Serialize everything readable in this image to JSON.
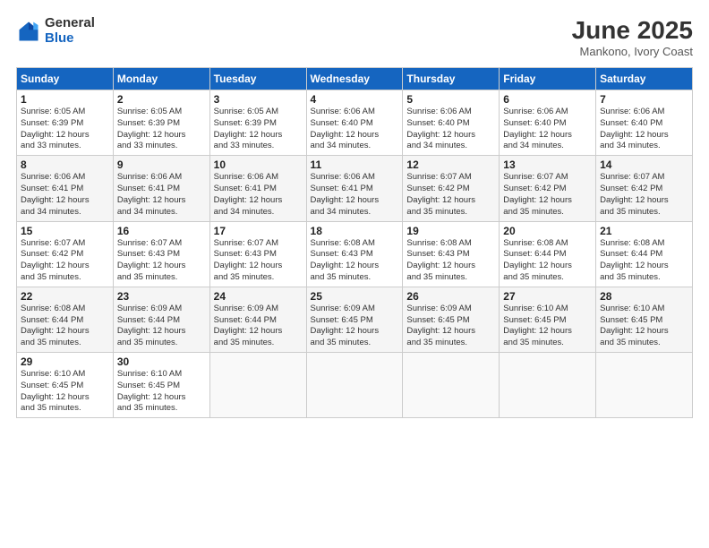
{
  "header": {
    "logo_general": "General",
    "logo_blue": "Blue",
    "month_title": "June 2025",
    "location": "Mankono, Ivory Coast"
  },
  "days_of_week": [
    "Sunday",
    "Monday",
    "Tuesday",
    "Wednesday",
    "Thursday",
    "Friday",
    "Saturday"
  ],
  "weeks": [
    [
      {
        "day": "1",
        "sunrise": "6:05 AM",
        "sunset": "6:39 PM",
        "daylight": "12 hours and 33 minutes."
      },
      {
        "day": "2",
        "sunrise": "6:05 AM",
        "sunset": "6:39 PM",
        "daylight": "12 hours and 33 minutes."
      },
      {
        "day": "3",
        "sunrise": "6:05 AM",
        "sunset": "6:39 PM",
        "daylight": "12 hours and 33 minutes."
      },
      {
        "day": "4",
        "sunrise": "6:06 AM",
        "sunset": "6:40 PM",
        "daylight": "12 hours and 34 minutes."
      },
      {
        "day": "5",
        "sunrise": "6:06 AM",
        "sunset": "6:40 PM",
        "daylight": "12 hours and 34 minutes."
      },
      {
        "day": "6",
        "sunrise": "6:06 AM",
        "sunset": "6:40 PM",
        "daylight": "12 hours and 34 minutes."
      },
      {
        "day": "7",
        "sunrise": "6:06 AM",
        "sunset": "6:40 PM",
        "daylight": "12 hours and 34 minutes."
      }
    ],
    [
      {
        "day": "8",
        "sunrise": "6:06 AM",
        "sunset": "6:41 PM",
        "daylight": "12 hours and 34 minutes."
      },
      {
        "day": "9",
        "sunrise": "6:06 AM",
        "sunset": "6:41 PM",
        "daylight": "12 hours and 34 minutes."
      },
      {
        "day": "10",
        "sunrise": "6:06 AM",
        "sunset": "6:41 PM",
        "daylight": "12 hours and 34 minutes."
      },
      {
        "day": "11",
        "sunrise": "6:06 AM",
        "sunset": "6:41 PM",
        "daylight": "12 hours and 34 minutes."
      },
      {
        "day": "12",
        "sunrise": "6:07 AM",
        "sunset": "6:42 PM",
        "daylight": "12 hours and 35 minutes."
      },
      {
        "day": "13",
        "sunrise": "6:07 AM",
        "sunset": "6:42 PM",
        "daylight": "12 hours and 35 minutes."
      },
      {
        "day": "14",
        "sunrise": "6:07 AM",
        "sunset": "6:42 PM",
        "daylight": "12 hours and 35 minutes."
      }
    ],
    [
      {
        "day": "15",
        "sunrise": "6:07 AM",
        "sunset": "6:42 PM",
        "daylight": "12 hours and 35 minutes."
      },
      {
        "day": "16",
        "sunrise": "6:07 AM",
        "sunset": "6:43 PM",
        "daylight": "12 hours and 35 minutes."
      },
      {
        "day": "17",
        "sunrise": "6:07 AM",
        "sunset": "6:43 PM",
        "daylight": "12 hours and 35 minutes."
      },
      {
        "day": "18",
        "sunrise": "6:08 AM",
        "sunset": "6:43 PM",
        "daylight": "12 hours and 35 minutes."
      },
      {
        "day": "19",
        "sunrise": "6:08 AM",
        "sunset": "6:43 PM",
        "daylight": "12 hours and 35 minutes."
      },
      {
        "day": "20",
        "sunrise": "6:08 AM",
        "sunset": "6:44 PM",
        "daylight": "12 hours and 35 minutes."
      },
      {
        "day": "21",
        "sunrise": "6:08 AM",
        "sunset": "6:44 PM",
        "daylight": "12 hours and 35 minutes."
      }
    ],
    [
      {
        "day": "22",
        "sunrise": "6:08 AM",
        "sunset": "6:44 PM",
        "daylight": "12 hours and 35 minutes."
      },
      {
        "day": "23",
        "sunrise": "6:09 AM",
        "sunset": "6:44 PM",
        "daylight": "12 hours and 35 minutes."
      },
      {
        "day": "24",
        "sunrise": "6:09 AM",
        "sunset": "6:44 PM",
        "daylight": "12 hours and 35 minutes."
      },
      {
        "day": "25",
        "sunrise": "6:09 AM",
        "sunset": "6:45 PM",
        "daylight": "12 hours and 35 minutes."
      },
      {
        "day": "26",
        "sunrise": "6:09 AM",
        "sunset": "6:45 PM",
        "daylight": "12 hours and 35 minutes."
      },
      {
        "day": "27",
        "sunrise": "6:10 AM",
        "sunset": "6:45 PM",
        "daylight": "12 hours and 35 minutes."
      },
      {
        "day": "28",
        "sunrise": "6:10 AM",
        "sunset": "6:45 PM",
        "daylight": "12 hours and 35 minutes."
      }
    ],
    [
      {
        "day": "29",
        "sunrise": "6:10 AM",
        "sunset": "6:45 PM",
        "daylight": "12 hours and 35 minutes."
      },
      {
        "day": "30",
        "sunrise": "6:10 AM",
        "sunset": "6:45 PM",
        "daylight": "12 hours and 35 minutes."
      },
      null,
      null,
      null,
      null,
      null
    ]
  ]
}
